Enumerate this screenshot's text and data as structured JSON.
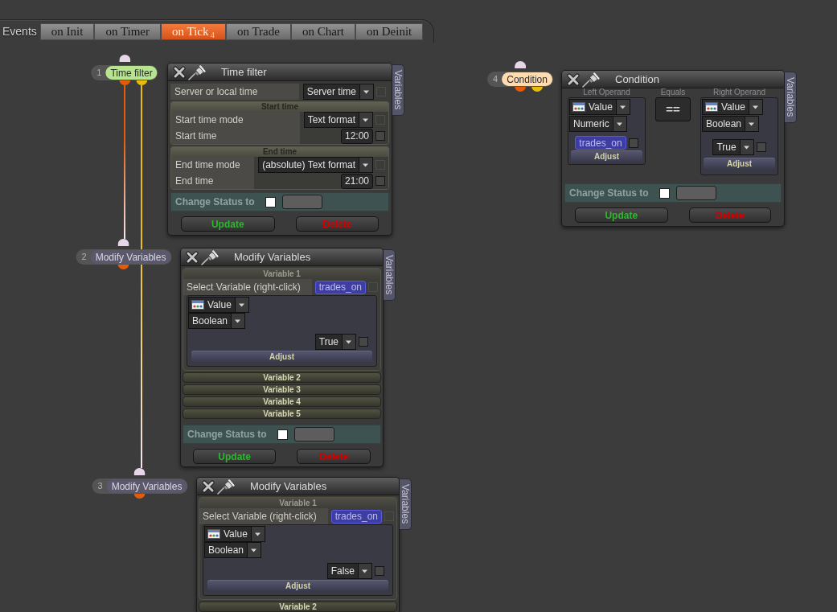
{
  "events_bar": {
    "label": "Events",
    "tabs": [
      {
        "label": "on Init",
        "selected": false
      },
      {
        "label": "on Timer",
        "selected": false
      },
      {
        "label": "on Tick",
        "selected": true,
        "count": "4"
      },
      {
        "label": "on Trade",
        "selected": false
      },
      {
        "label": "on Chart",
        "selected": false
      },
      {
        "label": "on Deinit",
        "selected": false
      }
    ]
  },
  "nodes": [
    {
      "kind": "time_filter",
      "number": "1",
      "label": "Time filter",
      "color": "#b7e48e",
      "outputs": [
        {
          "color": "#e35c0c",
          "linked": true
        },
        {
          "color": "#e8bb0c",
          "linked": true
        }
      ],
      "panel": {
        "title": "Time filter",
        "side_tab": "Variables",
        "rows": [
          {
            "kind": "dropdown",
            "label": "Server or local time",
            "value": "Server time",
            "checkbox": {
              "checked": false,
              "disabled": true
            }
          }
        ],
        "sections": [
          {
            "title": "Start time",
            "rows": [
              {
                "kind": "dropdown",
                "label": "Start time mode",
                "value": "Text format",
                "checkbox": {
                  "checked": false,
                  "disabled": true
                }
              },
              {
                "kind": "text",
                "label": "Start time",
                "value": "12:00",
                "checkbox": {
                  "checked": false,
                  "disabled": false
                }
              }
            ]
          },
          {
            "title": "End time",
            "rows": [
              {
                "kind": "dropdown",
                "label": "End time mode",
                "value": "(absolute) Text format",
                "checkbox": {
                  "checked": false,
                  "disabled": true
                }
              },
              {
                "kind": "text",
                "label": "End time",
                "value": "21:00",
                "checkbox": {
                  "checked": false,
                  "disabled": false
                }
              }
            ]
          }
        ],
        "change_status": {
          "label": "Change Status to",
          "checkbox": {
            "checked": false
          }
        },
        "buttons": [
          {
            "kind": "update",
            "label": "Update"
          },
          {
            "kind": "delete",
            "label": "Delete"
          }
        ]
      }
    },
    {
      "kind": "modify_variables",
      "number": "2",
      "label": "Modify Variables",
      "color": "#5a586a",
      "outputs": [
        {
          "color": "#e35c0c",
          "linked": false
        }
      ],
      "panel": {
        "title": "Modify Variables",
        "side_tab": "Variables",
        "variables": [
          {
            "title": "Variable 1",
            "expanded": true,
            "select_label": "Select Variable (right-click)",
            "variable": "trades_on",
            "variable_checkbox": {
              "checked": false,
              "disabled": true
            },
            "source": "Value",
            "type": "Boolean",
            "value": "True",
            "checkbox": {
              "checked": false,
              "disabled": false
            },
            "adjust": "Adjust"
          },
          {
            "title": "Variable 2",
            "expanded": false
          },
          {
            "title": "Variable 3",
            "expanded": false
          },
          {
            "title": "Variable 4",
            "expanded": false
          },
          {
            "title": "Variable 5",
            "expanded": false
          }
        ],
        "change_status": {
          "label": "Change Status to",
          "checkbox": {
            "checked": false
          }
        },
        "buttons": [
          {
            "kind": "update",
            "label": "Update"
          },
          {
            "kind": "delete",
            "label": "Delete"
          }
        ]
      }
    },
    {
      "kind": "modify_variables",
      "number": "3",
      "label": "Modify Variables",
      "color": "#5a586a",
      "outputs": [
        {
          "color": "#e35c0c",
          "linked": false
        }
      ],
      "panel": {
        "title": "Modify Variables",
        "side_tab": "Variables",
        "variables": [
          {
            "title": "Variable 1",
            "expanded": true,
            "select_label": "Select Variable (right-click)",
            "variable": "trades_on",
            "variable_checkbox": {
              "checked": false,
              "disabled": true
            },
            "source": "Value",
            "type": "Boolean",
            "value": "False",
            "checkbox": {
              "checked": false,
              "disabled": false
            },
            "adjust": "Adjust"
          },
          {
            "title": "Variable 2",
            "expanded": false
          }
        ]
      }
    },
    {
      "kind": "condition",
      "number": "4",
      "label": "Condition",
      "color": "#fedcaf",
      "outputs": [
        {
          "color": "#e35c0c",
          "linked": false
        },
        {
          "color": "#e8bb0c",
          "linked": false
        }
      ],
      "panel": {
        "title": "Condition",
        "side_tab": "Variables",
        "left_operand": {
          "title": "Left Operand",
          "source": "Value",
          "type": "Numeric",
          "operand": {
            "kind": "variable",
            "text": "trades_on",
            "checkbox": {
              "checked": false,
              "disabled": false
            }
          },
          "adjust": "Adjust"
        },
        "operator": {
          "title": "Equals",
          "symbol": "=="
        },
        "right_operand": {
          "title": "Right Operand",
          "source": "Value",
          "type": "Boolean",
          "operand": {
            "kind": "dropdown",
            "text": "True",
            "checkbox": {
              "checked": false,
              "disabled": false
            }
          },
          "adjust": "Adjust"
        },
        "change_status": {
          "label": "Change Status to",
          "checkbox": {
            "checked": false
          }
        },
        "buttons": [
          {
            "kind": "update",
            "label": "Update"
          },
          {
            "kind": "delete",
            "label": "Delete"
          }
        ]
      }
    }
  ]
}
